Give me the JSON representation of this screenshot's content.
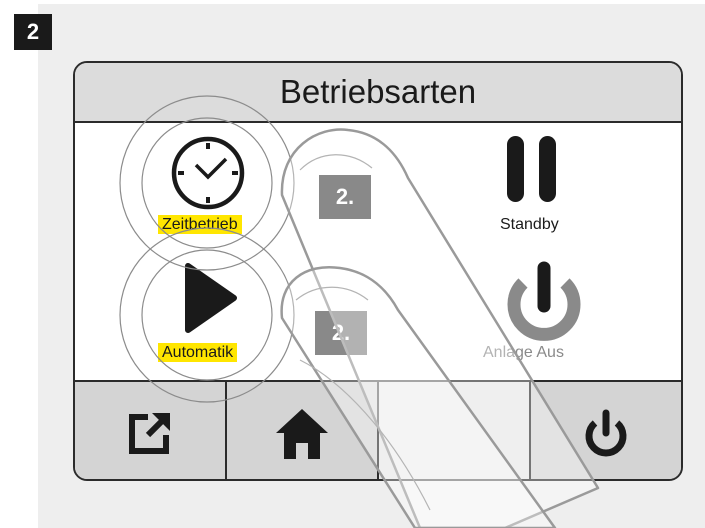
{
  "step_number": "2",
  "screen": {
    "title": "Betriebsarten",
    "modes": {
      "zeitbetrieb": "Zeitbetrieb",
      "standby": "Standby",
      "automatik": "Automatik",
      "anlage_aus": "Anlage Aus"
    },
    "step_markers": [
      "2.",
      "2."
    ]
  },
  "nav": {
    "icons": [
      "external-link-icon",
      "home-icon",
      "",
      "power-icon"
    ]
  },
  "colors": {
    "highlight": "#ffe600",
    "header": "#dcdcdc",
    "nav": "#d4d4d4",
    "marker": "#4a4a4a"
  }
}
